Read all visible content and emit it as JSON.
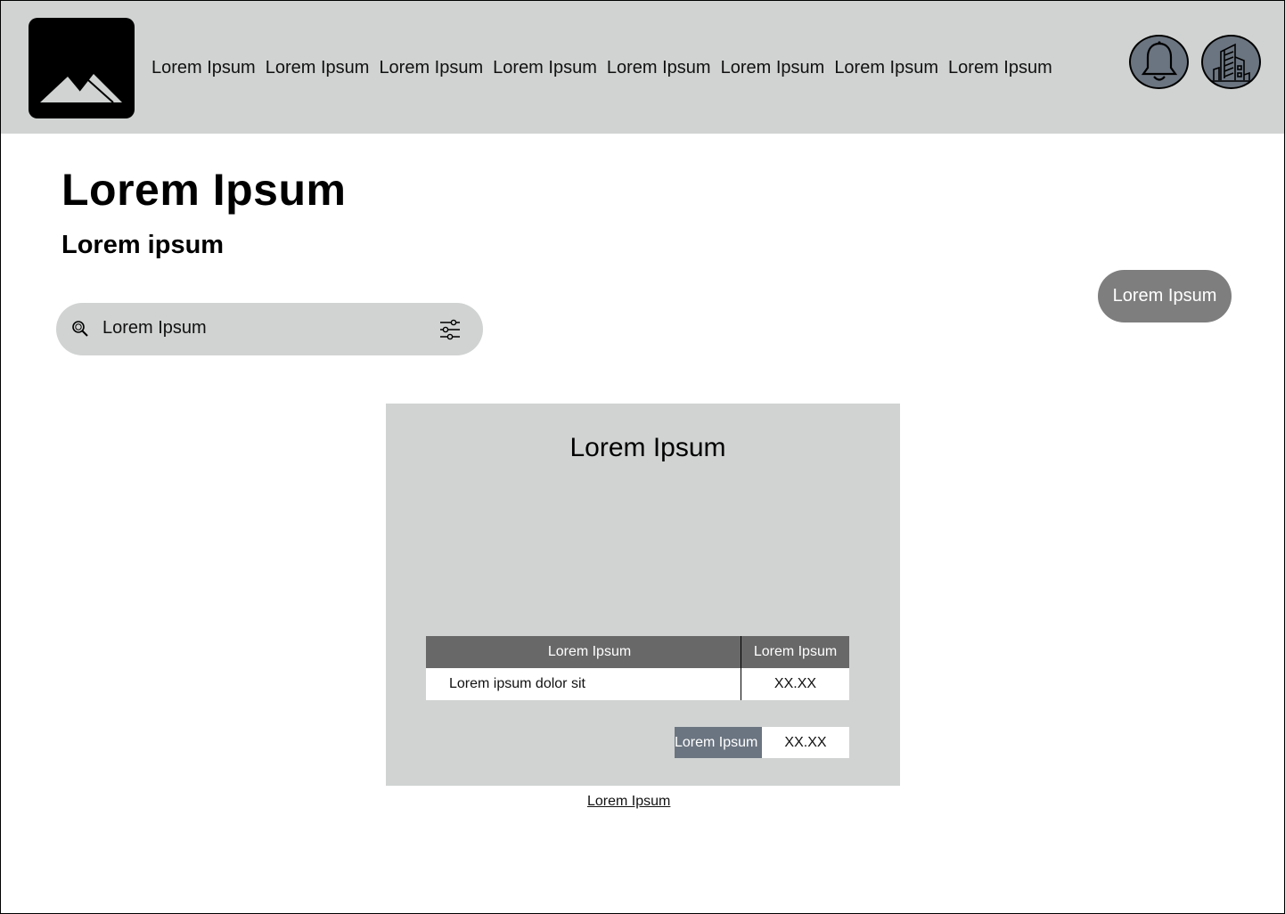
{
  "header": {
    "nav_items": [
      {
        "label": "Lorem Ipsum"
      },
      {
        "label": "Lorem Ipsum"
      },
      {
        "label": "Lorem Ipsum"
      },
      {
        "label": "Lorem Ipsum"
      },
      {
        "label": "Lorem Ipsum"
      },
      {
        "label": "Lorem Ipsum"
      },
      {
        "label": "Lorem Ipsum"
      },
      {
        "label": "Lorem Ipsum"
      }
    ],
    "icons": [
      "image-logo-icon",
      "bell-icon",
      "building-icon"
    ]
  },
  "page": {
    "title": "Lorem Ipsum",
    "subtitle": "Lorem ipsum"
  },
  "search": {
    "placeholder": "Lorem Ipsum"
  },
  "action_button": {
    "label": "Lorem Ipsum"
  },
  "card": {
    "title": "Lorem Ipsum",
    "table": {
      "headers": [
        "Lorem Ipsum",
        "Lorem Ipsum"
      ],
      "rows": [
        [
          "Lorem ipsum dolor sit",
          "XX.XX"
        ]
      ]
    },
    "total": {
      "label": "Lorem Ipsum",
      "value": "XX.XX"
    }
  },
  "footer_link": "Lorem Ipsum",
  "colors": {
    "header_bg": "#d0d3d2",
    "icon_button_bg": "#6b7581",
    "action_button_bg": "#7e7e7e",
    "table_header_bg": "#686868"
  }
}
